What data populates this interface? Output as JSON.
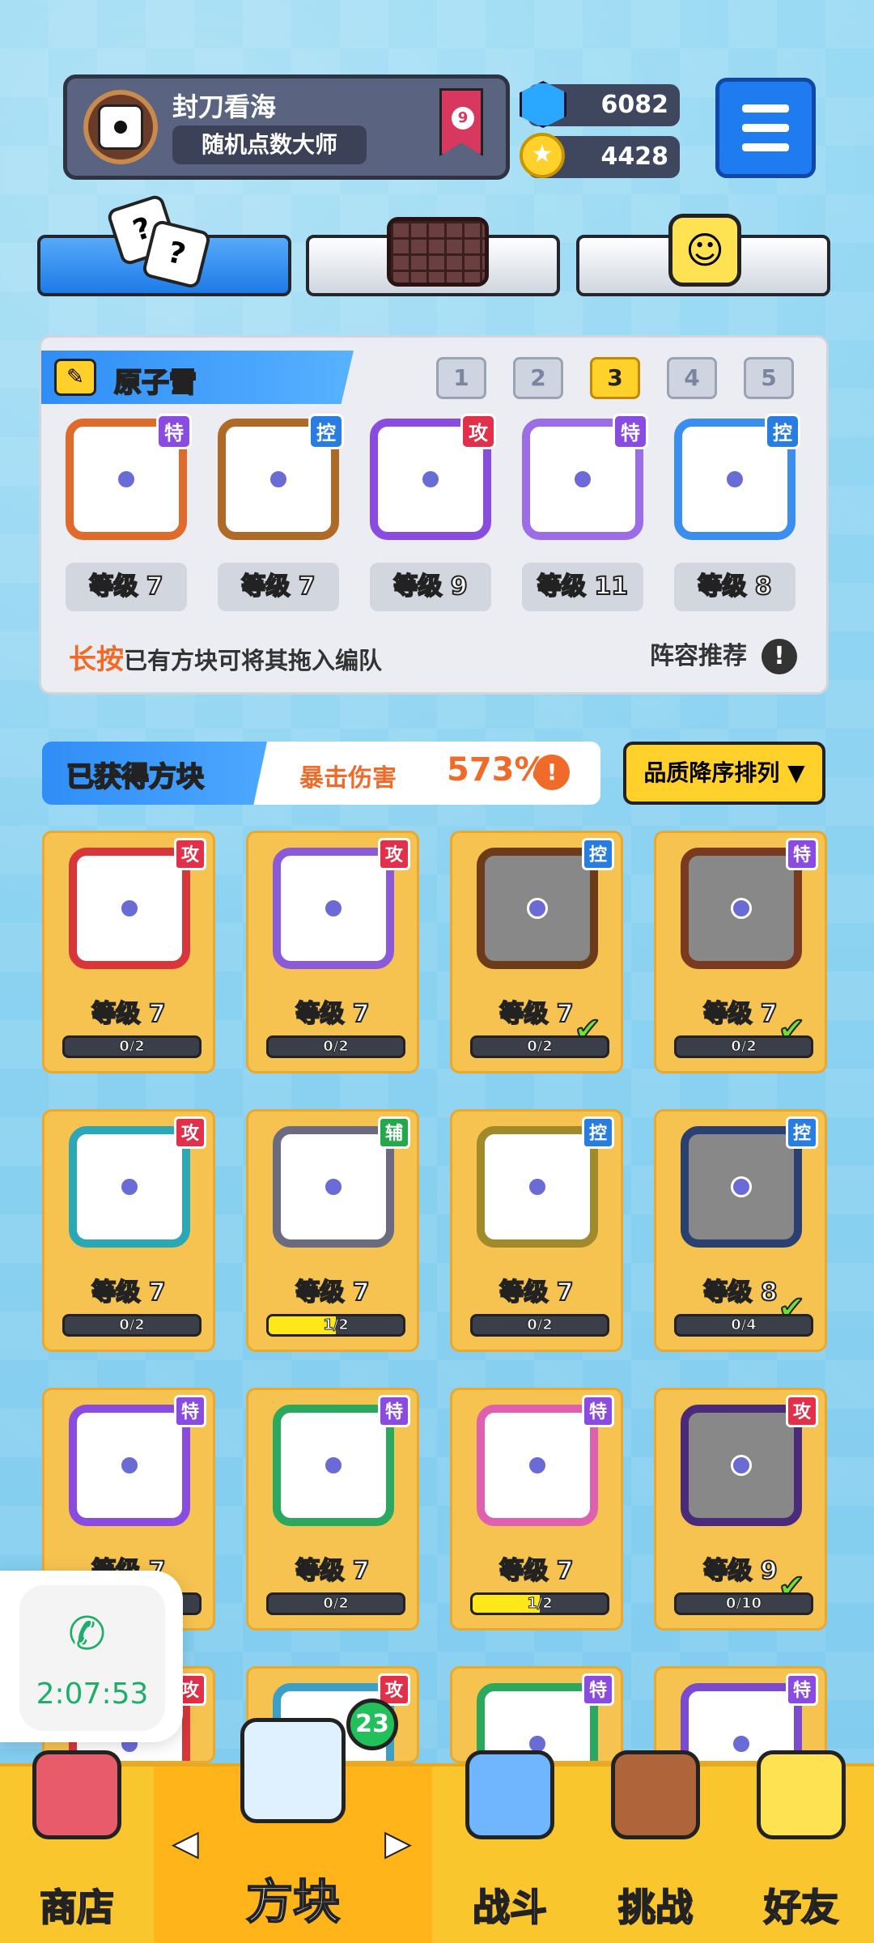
{
  "player": {
    "name": "封刀看海",
    "title": "随机点数大师",
    "rank": "9"
  },
  "resources": {
    "gems": "6082",
    "coins": "4428"
  },
  "team": {
    "title": "原子雪",
    "slots": [
      "1",
      "2",
      "3",
      "4",
      "5"
    ],
    "active_slot": "3",
    "cards": [
      {
        "badge": "特",
        "badge_color": "#8a4be0",
        "frame": "#e06a2a",
        "level": "等级 7"
      },
      {
        "badge": "控",
        "badge_color": "#2a7de0",
        "frame": "#b06a28",
        "level": "等级 7"
      },
      {
        "badge": "攻",
        "badge_color": "#e0304a",
        "frame": "#8a4be0",
        "level": "等级 9"
      },
      {
        "badge": "特",
        "badge_color": "#8a4be0",
        "frame": "#9b6ee8",
        "level": "等级 11"
      },
      {
        "badge": "控",
        "badge_color": "#2a7de0",
        "frame": "#3a8ef0",
        "level": "等级 8"
      }
    ],
    "hint_highlight": "长按",
    "hint_text": "已有方块可将其拖入编队",
    "recommend": "阵容推荐"
  },
  "owned": {
    "title": "已获得方块",
    "crit_label": "暴击伤害",
    "crit_value": "573%",
    "sort_label": "品质降序排列 ▼"
  },
  "grid": [
    {
      "badge": "攻",
      "badge_color": "#e0304a",
      "frame": "#d8363a",
      "level": "等级 7",
      "progress": "0/2",
      "fill": 0,
      "check": false,
      "gray": false
    },
    {
      "badge": "攻",
      "badge_color": "#e0304a",
      "frame": "#8a5ad8",
      "level": "等级 7",
      "progress": "0/2",
      "fill": 0,
      "check": false,
      "gray": false
    },
    {
      "badge": "控",
      "badge_color": "#2a7de0",
      "frame": "#6b3b1a",
      "level": "等级 7",
      "progress": "0/2",
      "fill": 0,
      "check": true,
      "gray": true
    },
    {
      "badge": "特",
      "badge_color": "#8a4be0",
      "frame": "#7a3a20",
      "level": "等级 7",
      "progress": "0/2",
      "fill": 0,
      "check": true,
      "gray": true
    },
    {
      "badge": "攻",
      "badge_color": "#e0304a",
      "frame": "#2aa8b8",
      "level": "等级 7",
      "progress": "0/2",
      "fill": 0,
      "check": false,
      "gray": false
    },
    {
      "badge": "辅",
      "badge_color": "#24a84a",
      "frame": "#6a6a80",
      "level": "等级 7",
      "progress": "1/2",
      "fill": 0.5,
      "check": false,
      "gray": false
    },
    {
      "badge": "控",
      "badge_color": "#2a7de0",
      "frame": "#a08a2a",
      "level": "等级 7",
      "progress": "0/2",
      "fill": 0,
      "check": false,
      "gray": false
    },
    {
      "badge": "控",
      "badge_color": "#2a7de0",
      "frame": "#2a4070",
      "level": "等级 8",
      "progress": "0/4",
      "fill": 0,
      "check": true,
      "gray": true
    },
    {
      "badge": "特",
      "badge_color": "#8a4be0",
      "frame": "#8a4be0",
      "level": "等级 7",
      "progress": "0/2",
      "fill": 0,
      "check": false,
      "gray": false
    },
    {
      "badge": "特",
      "badge_color": "#8a4be0",
      "frame": "#2aa860",
      "level": "等级 7",
      "progress": "0/2",
      "fill": 0,
      "check": false,
      "gray": false
    },
    {
      "badge": "特",
      "badge_color": "#8a4be0",
      "frame": "#e060b0",
      "level": "等级 7",
      "progress": "1/2",
      "fill": 0.5,
      "check": false,
      "gray": false
    },
    {
      "badge": "攻",
      "badge_color": "#e0304a",
      "frame": "#4a2a7a",
      "level": "等级 9",
      "progress": "0/10",
      "fill": 0,
      "check": true,
      "gray": true
    },
    {
      "badge": "攻",
      "badge_color": "#e0304a",
      "frame": "#d8363a",
      "level": "",
      "progress": "",
      "fill": 0,
      "check": false,
      "gray": false
    },
    {
      "badge": "攻",
      "badge_color": "#e0304a",
      "frame": "#3aa0c8",
      "level": "",
      "progress": "",
      "fill": 0,
      "check": false,
      "gray": false
    },
    {
      "badge": "特",
      "badge_color": "#8a4be0",
      "frame": "#2aa860",
      "level": "",
      "progress": "",
      "fill": 0,
      "check": false,
      "gray": false
    },
    {
      "badge": "特",
      "badge_color": "#8a4be0",
      "frame": "#7a4bd1",
      "level": "",
      "progress": "",
      "fill": 0,
      "check": false,
      "gray": false
    }
  ],
  "call": {
    "timer": "2:07:53",
    "icon": "phone-icon"
  },
  "nav": {
    "shop": "商店",
    "blocks": "方块",
    "battle": "战斗",
    "challenge": "挑战",
    "friends": "好友",
    "blocks_count": "23"
  }
}
